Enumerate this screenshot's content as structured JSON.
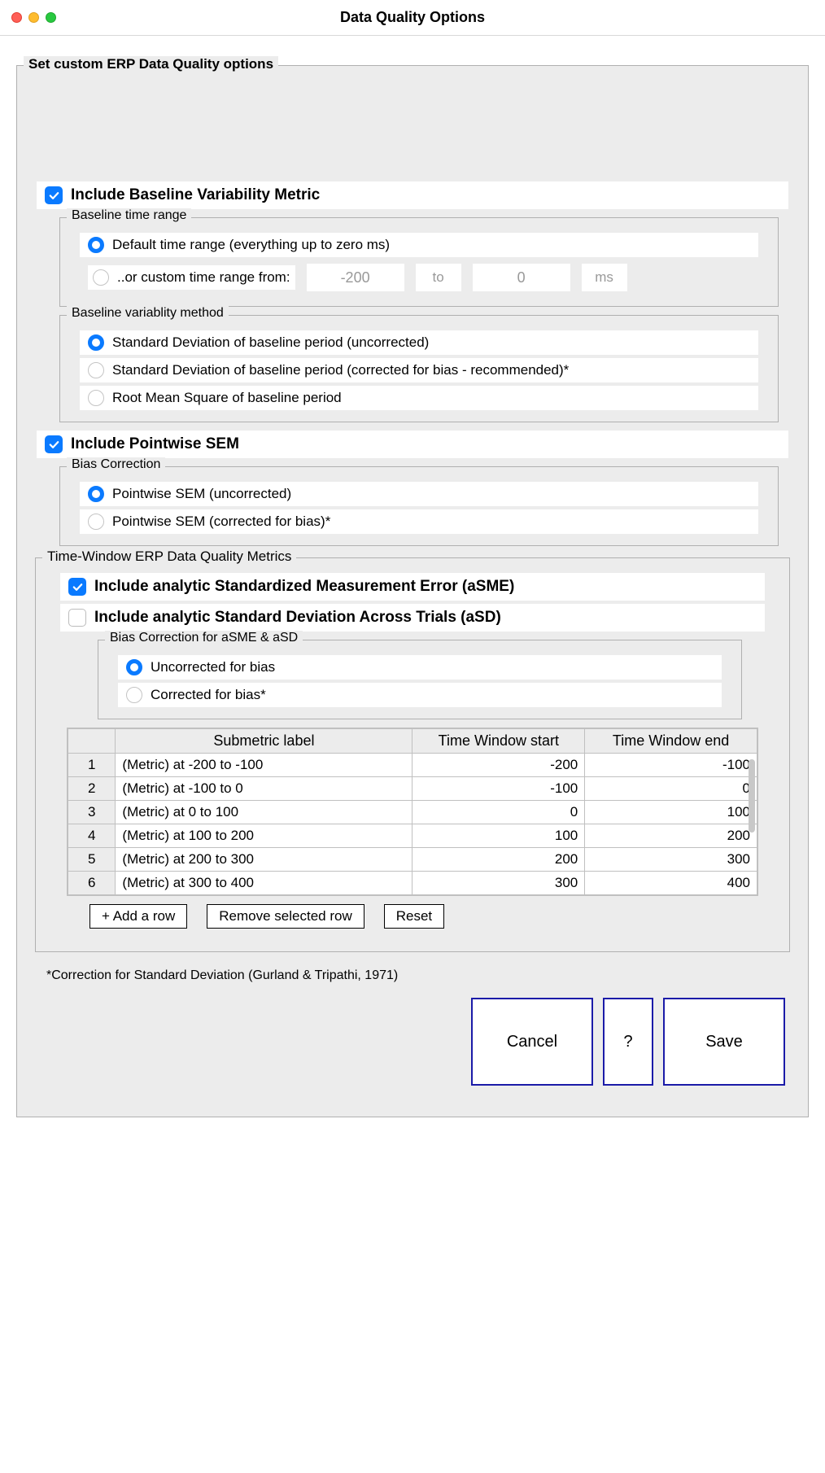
{
  "window": {
    "title": "Data Quality Options"
  },
  "main_legend": "Set custom ERP Data Quality options",
  "baseline": {
    "check_label": "Include Baseline Variability Metric",
    "range_legend": "Baseline time range",
    "range_opt1": "Default time range (everything up to zero ms)",
    "range_opt2": "..or custom time range from:",
    "range_from": "-200",
    "range_to_label": "to",
    "range_to": "0",
    "range_unit": "ms",
    "method_legend": "Baseline variablity method",
    "method_opt1": "Standard Deviation of baseline period (uncorrected)",
    "method_opt2": "Standard Deviation of baseline period (corrected for bias - recommended)*",
    "method_opt3": "Root Mean Square of baseline period"
  },
  "sem": {
    "check_label": "Include Pointwise SEM",
    "bias_legend": "Bias Correction",
    "bias_opt1": "Pointwise SEM (uncorrected)",
    "bias_opt2": "Pointwise SEM (corrected for bias)*"
  },
  "tw": {
    "legend": "Time-Window ERP Data Quality Metrics",
    "asme_label": "Include analytic Standardized Measurement Error (aSME)",
    "asd_label": "Include analytic Standard Deviation Across Trials (aSD)",
    "bias_legend": "Bias Correction for aSME & aSD",
    "bias_opt1": "Uncorrected for bias",
    "bias_opt2": "Corrected for bias*",
    "table": {
      "headers": {
        "label": "Submetric label",
        "start": "Time Window start",
        "end": "Time Window end"
      },
      "rows": [
        {
          "i": "1",
          "label": "(Metric) at -200 to -100",
          "start": "-200",
          "end": "-100"
        },
        {
          "i": "2",
          "label": "(Metric) at -100 to 0",
          "start": "-100",
          "end": "0"
        },
        {
          "i": "3",
          "label": "(Metric) at 0 to 100",
          "start": "0",
          "end": "100"
        },
        {
          "i": "4",
          "label": "(Metric) at 100 to 200",
          "start": "100",
          "end": "200"
        },
        {
          "i": "5",
          "label": "(Metric) at 200 to 300",
          "start": "200",
          "end": "300"
        },
        {
          "i": "6",
          "label": "(Metric) at 300 to 400",
          "start": "300",
          "end": "400"
        }
      ]
    },
    "add_row": "+ Add a row",
    "remove_row": "Remove selected row",
    "reset": "Reset"
  },
  "footnote": "*Correction for Standard Deviation (Gurland & Tripathi, 1971)",
  "buttons": {
    "cancel": "Cancel",
    "help": "?",
    "save": "Save"
  }
}
